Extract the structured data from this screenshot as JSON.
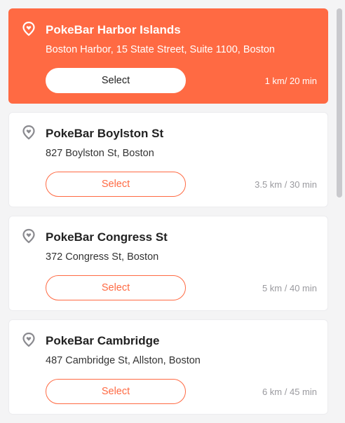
{
  "colors": {
    "accent": "#ff6a43",
    "pin_default": "#8a8a8f",
    "pin_selected": "#ffffff"
  },
  "icons": {
    "location": "location-pin-icon"
  },
  "locations": [
    {
      "name": "PokeBar Harbor Islands",
      "address": "Boston Harbor, 15 State Street, Suite 1100, Boston",
      "button_label": "Select",
      "distance": "1 km/ 20 min",
      "selected": true
    },
    {
      "name": "PokeBar Boylston St",
      "address": "827 Boylston St, Boston",
      "button_label": "Select",
      "distance": "3.5 km / 30 min",
      "selected": false
    },
    {
      "name": "PokeBar Congress St",
      "address": "372 Congress St, Boston",
      "button_label": "Select",
      "distance": "5 km / 40 min",
      "selected": false
    },
    {
      "name": "PokeBar Cambridge",
      "address": "487 Cambridge St, Allston, Boston",
      "button_label": "Select",
      "distance": "6 km / 45 min",
      "selected": false
    }
  ]
}
